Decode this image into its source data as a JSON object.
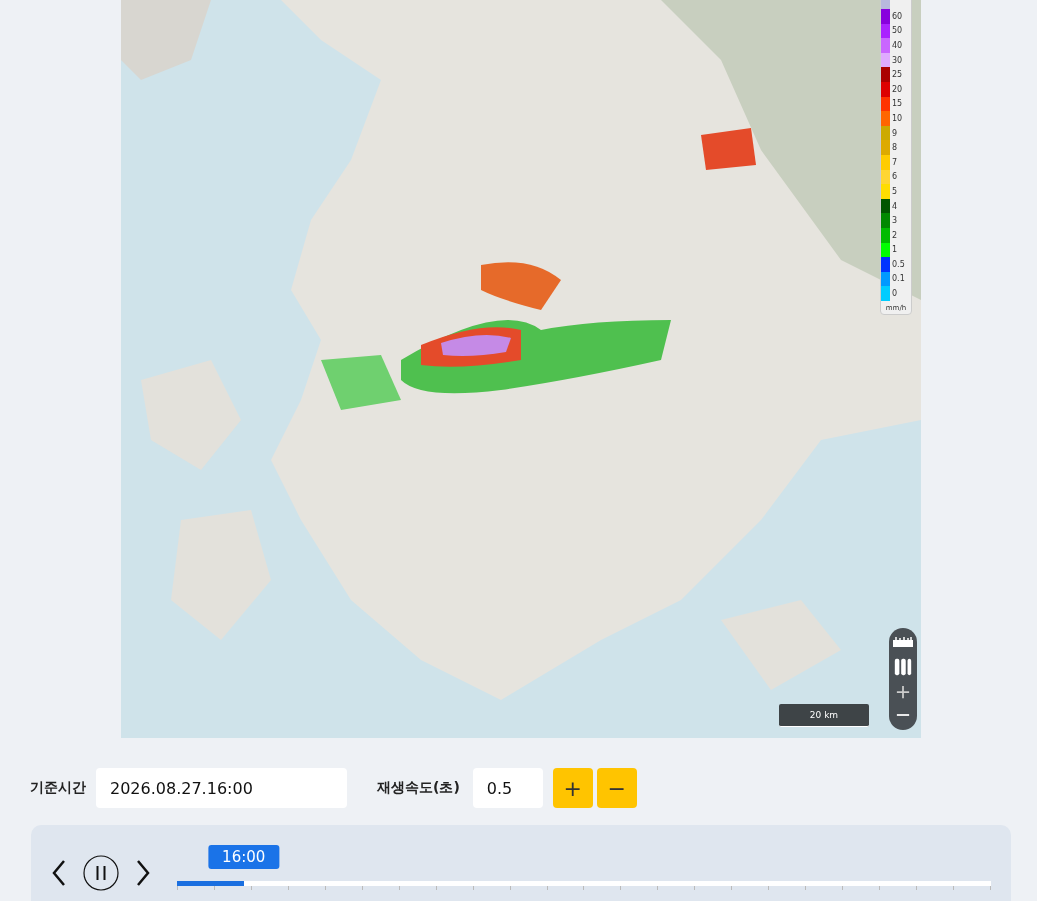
{
  "map": {
    "legend": {
      "unit": "mm/h",
      "items": [
        {
          "label": "60",
          "color": "#8800dd"
        },
        {
          "label": "50",
          "color": "#aa22ff"
        },
        {
          "label": "40",
          "color": "#c966ff"
        },
        {
          "label": "30",
          "color": "#dfaaff"
        },
        {
          "label": "25",
          "color": "#aa0000"
        },
        {
          "label": "20",
          "color": "#dd0000"
        },
        {
          "label": "15",
          "color": "#ff3300"
        },
        {
          "label": "10",
          "color": "#ff6600"
        },
        {
          "label": "9",
          "color": "#ccaa00"
        },
        {
          "label": "8",
          "color": "#ddaa00"
        },
        {
          "label": "7",
          "color": "#ffcc00"
        },
        {
          "label": "6",
          "color": "#ffd633"
        },
        {
          "label": "5",
          "color": "#ffdd00"
        },
        {
          "label": "4",
          "color": "#005500"
        },
        {
          "label": "3",
          "color": "#008800"
        },
        {
          "label": "2",
          "color": "#00bb00"
        },
        {
          "label": "1",
          "color": "#00ff00"
        },
        {
          "label": "0.5",
          "color": "#0033ff"
        },
        {
          "label": "0.1",
          "color": "#0099ff"
        },
        {
          "label": "0",
          "color": "#00ccff"
        }
      ]
    },
    "scale": "20 km"
  },
  "controls": {
    "base_time_label": "기준시간",
    "base_time": "2026.08.27.16:00",
    "speed_label": "재생속도(초)",
    "speed": "0.5",
    "plus": "+",
    "minus": "−"
  },
  "timeline": {
    "current": "16:00",
    "level": 0.082,
    "playing": true
  }
}
